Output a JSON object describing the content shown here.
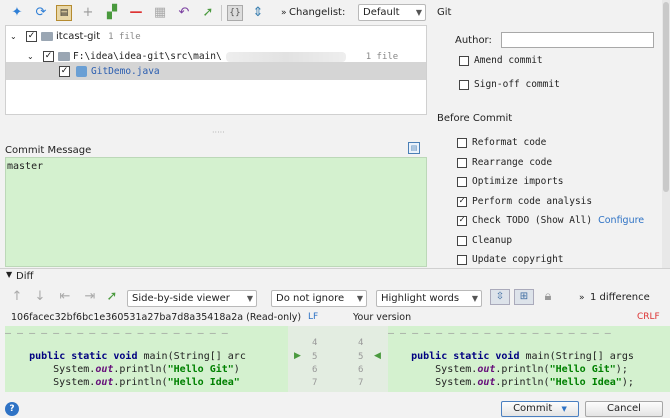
{
  "toolbar": {
    "icons": [
      "move-icon",
      "refresh-icon",
      "group-icon",
      "add-icon",
      "move-to-changelist-icon",
      "remove-icon",
      "diff-icon",
      "rollback-icon",
      "jump-icon",
      "expand-icon",
      "collapse-icon"
    ],
    "changelist_label": "Changelist:",
    "changelist_value": "Default"
  },
  "tree": {
    "root": {
      "name": "itcast-git",
      "count": "1 file"
    },
    "folder": {
      "path": "F:\\idea\\idea-git\\src\\main\\",
      "count": "1 file"
    },
    "file": {
      "name": "GitDemo.java"
    }
  },
  "commit_message": {
    "label": "Commit Message",
    "value": "master"
  },
  "git": {
    "section": "Git",
    "author_label": "Author:",
    "author_value": "",
    "amend": "Amend commit",
    "signoff": "Sign-off commit"
  },
  "before_commit": {
    "section": "Before Commit",
    "options": [
      {
        "label": "Reformat code",
        "checked": false
      },
      {
        "label": "Rearrange code",
        "checked": false
      },
      {
        "label": "Optimize imports",
        "checked": false
      },
      {
        "label": "Perform code analysis",
        "checked": true
      },
      {
        "label": "Check TODO (Show All)",
        "checked": true
      },
      {
        "label": "Cleanup",
        "checked": false
      },
      {
        "label": "Update copyright",
        "checked": false
      }
    ],
    "configure_link": "Configure"
  },
  "diff": {
    "title": "Diff",
    "viewer": "Side-by-side viewer",
    "whitespace": "Do not ignore",
    "highlight": "Highlight words",
    "difference_count": "1 difference",
    "left_header": "106facec32bf6bc1e360531a27ba7d8a35418a2a (Read-only)",
    "line_ending_left": "LF",
    "right_header": "Your version",
    "line_ending_right": "CRLF",
    "left_lines": [
      {
        "num": "4",
        "code": ""
      },
      {
        "num": "5",
        "code": "    public static void main(String[] arc"
      },
      {
        "num": "6",
        "code": "        System.out.println(\"Hello Git\");"
      },
      {
        "num": "7",
        "code": "        System.out.println(\"Hello Idea\""
      }
    ],
    "right_lines": [
      {
        "num": "4",
        "code": ""
      },
      {
        "num": "5",
        "code": "    public static void main(String[] args"
      },
      {
        "num": "6",
        "code": "        System.out.println(\"Hello Git\");"
      },
      {
        "num": "7",
        "code": "        System.out.println(\"Hello Idea\");"
      }
    ]
  },
  "footer": {
    "help": "?",
    "commit_button": "Commit",
    "cancel_button": "Cancel"
  }
}
